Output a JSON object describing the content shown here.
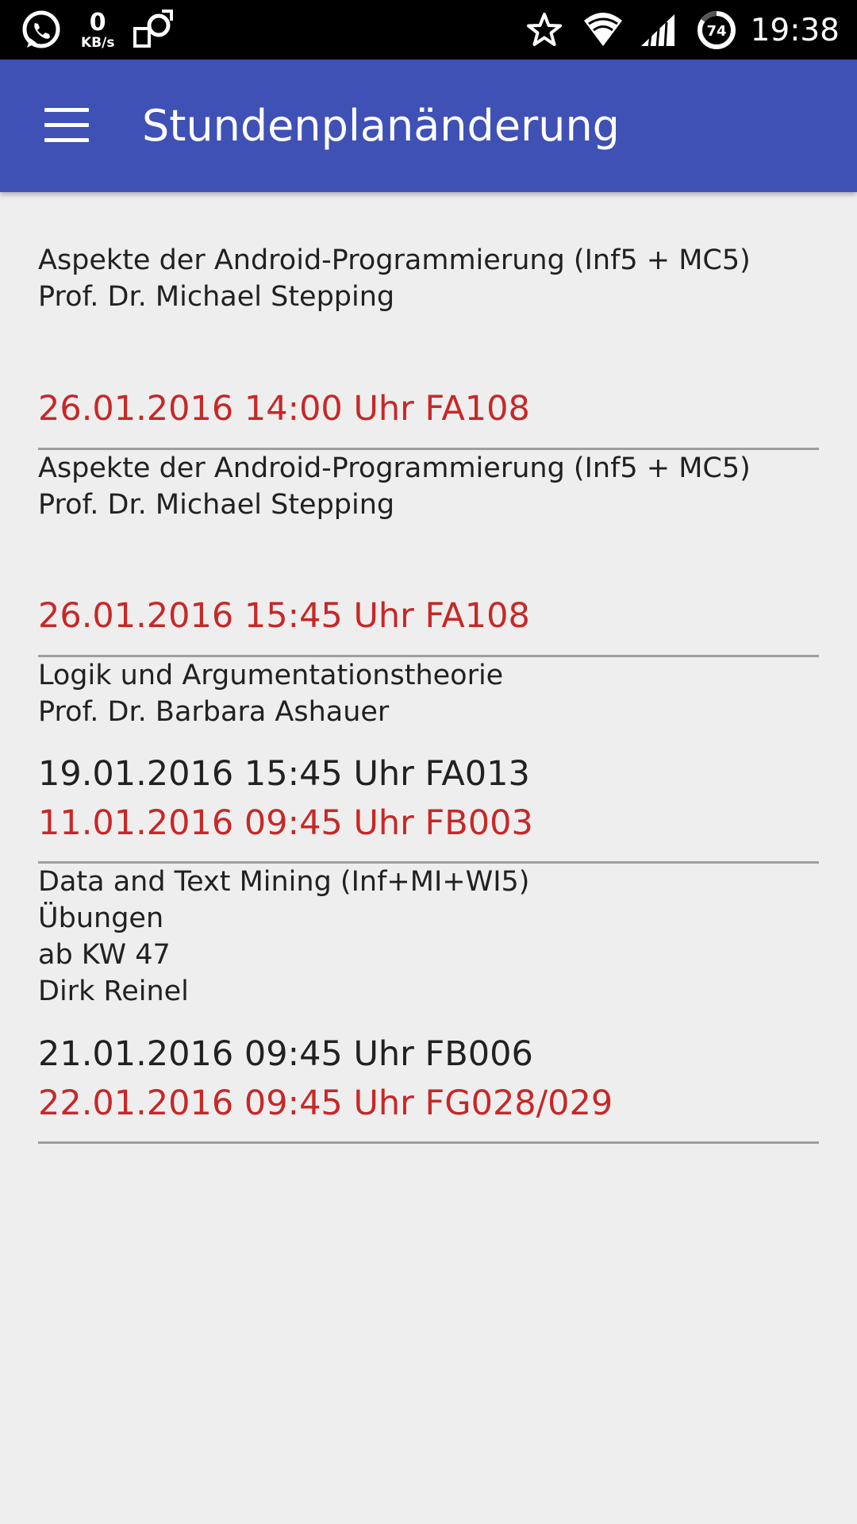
{
  "status_bar": {
    "left_icons": [
      "whatsapp-icon",
      "screen-rotate-icon"
    ],
    "speed_value": "0",
    "speed_unit": "KB/s",
    "right_icons": [
      "star-icon",
      "wifi-icon",
      "signal-icon",
      "battery-icon"
    ],
    "battery_level": "74",
    "time": "19:38"
  },
  "app_bar": {
    "title": "Stundenplanänderung",
    "menu_icon": "hamburger-menu-icon",
    "color": "#3f51b5"
  },
  "colors": {
    "background": "#eeeeee",
    "new_date": "#c62828",
    "text": "#212121",
    "divider": "#9e9e9e"
  },
  "entries": [
    {
      "lines": [
        "Aspekte der Android-Programmierung (Inf5 + MC5)",
        "Prof. Dr. Michael Stepping"
      ],
      "old_date": "",
      "new_date": "26.01.2016 14:00 Uhr FA108"
    },
    {
      "lines": [
        "Aspekte der Android-Programmierung (Inf5 + MC5)",
        "Prof. Dr. Michael Stepping"
      ],
      "old_date": "",
      "new_date": "26.01.2016 15:45 Uhr FA108"
    },
    {
      "lines": [
        "Logik und Argumentationstheorie",
        "Prof. Dr. Barbara Ashauer"
      ],
      "old_date": "19.01.2016 15:45 Uhr FA013",
      "new_date": "11.01.2016 09:45 Uhr FB003"
    },
    {
      "lines": [
        "Data and Text Mining (Inf+MI+WI5)",
        "Übungen",
        "ab KW 47",
        "Dirk Reinel"
      ],
      "old_date": "21.01.2016 09:45 Uhr FB006",
      "new_date": "22.01.2016 09:45 Uhr FG028/029"
    }
  ]
}
